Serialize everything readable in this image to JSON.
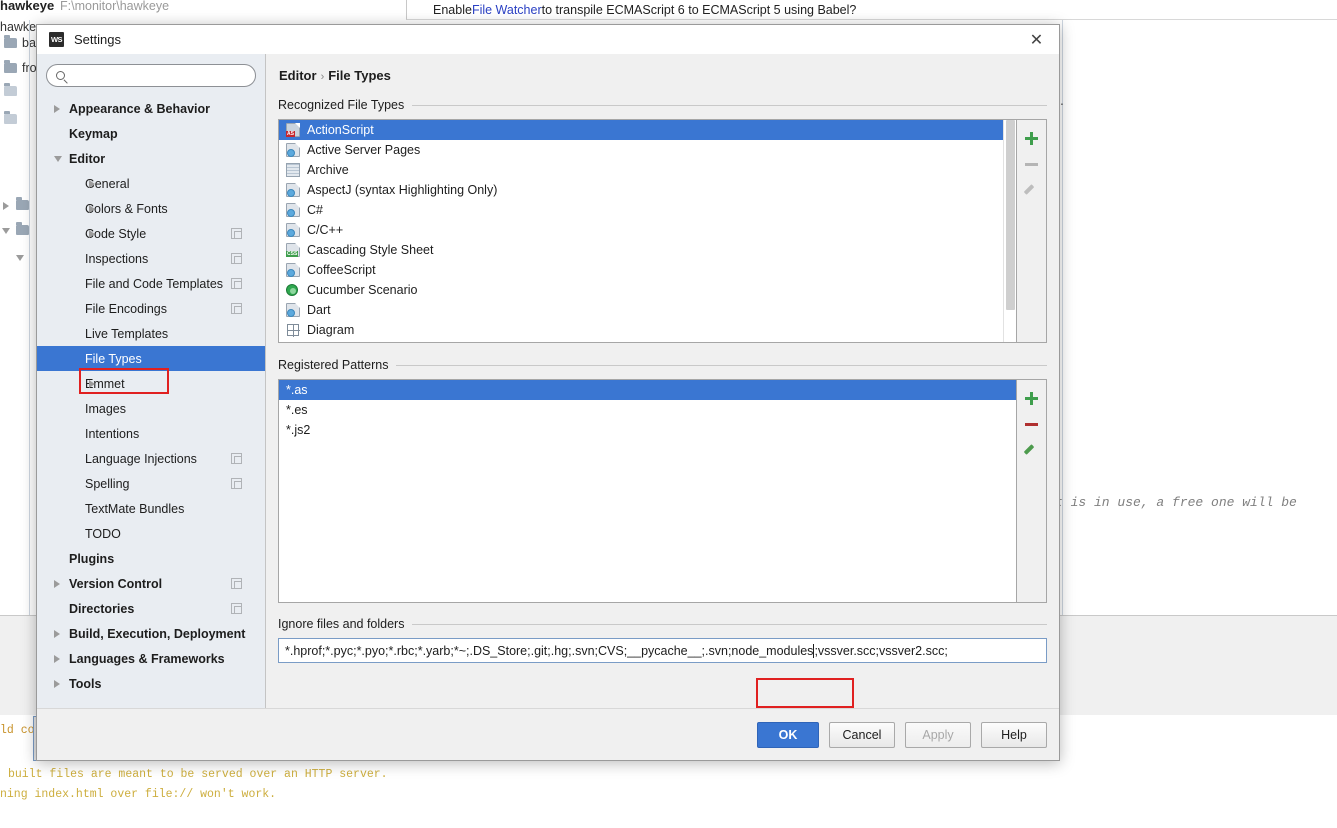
{
  "background": {
    "project_name": "hawkeye",
    "project_path": "F:\\monitor\\hawkeye",
    "tree_rows": [
      "hawkeye",
      "bac",
      "fro"
    ],
    "notification": {
      "prefix": "Enable ",
      "link": "File Watcher",
      "suffix": " to transpile ECMAScript 6 to ECMAScript 5 using Babel?"
    },
    "editor_italic_text": "t is in use, a free one will be",
    "console_lines": [
      "ld com",
      "built files are meant to be served over an HTTP server.",
      "ning index.html over file:// won't work."
    ],
    "dot": "."
  },
  "dialog": {
    "icon": "webstorm-icon",
    "title": "Settings",
    "close_icon": "close-icon",
    "search": {
      "icon": "search-icon",
      "value": "",
      "placeholder": ""
    },
    "tree": [
      {
        "label": "Appearance & Behavior",
        "level": 0,
        "bold": true,
        "arrow": "right",
        "copy": false,
        "selected": false
      },
      {
        "label": "Keymap",
        "level": 0,
        "bold": true,
        "arrow": "none",
        "copy": false,
        "selected": false
      },
      {
        "label": "Editor",
        "level": 0,
        "bold": true,
        "arrow": "down",
        "copy": false,
        "selected": false
      },
      {
        "label": "General",
        "level": 1,
        "bold": false,
        "arrow": "right",
        "copy": false,
        "selected": false
      },
      {
        "label": "Colors & Fonts",
        "level": 1,
        "bold": false,
        "arrow": "right",
        "copy": false,
        "selected": false
      },
      {
        "label": "Code Style",
        "level": 1,
        "bold": false,
        "arrow": "right",
        "copy": true,
        "selected": false
      },
      {
        "label": "Inspections",
        "level": 1,
        "bold": false,
        "arrow": "none",
        "copy": true,
        "selected": false
      },
      {
        "label": "File and Code Templates",
        "level": 1,
        "bold": false,
        "arrow": "none",
        "copy": true,
        "selected": false
      },
      {
        "label": "File Encodings",
        "level": 1,
        "bold": false,
        "arrow": "none",
        "copy": true,
        "selected": false
      },
      {
        "label": "Live Templates",
        "level": 1,
        "bold": false,
        "arrow": "none",
        "copy": false,
        "selected": false
      },
      {
        "label": "File Types",
        "level": 1,
        "bold": false,
        "arrow": "none",
        "copy": false,
        "selected": true
      },
      {
        "label": "Emmet",
        "level": 1,
        "bold": false,
        "arrow": "right",
        "copy": false,
        "selected": false
      },
      {
        "label": "Images",
        "level": 1,
        "bold": false,
        "arrow": "none",
        "copy": false,
        "selected": false
      },
      {
        "label": "Intentions",
        "level": 1,
        "bold": false,
        "arrow": "none",
        "copy": false,
        "selected": false
      },
      {
        "label": "Language Injections",
        "level": 1,
        "bold": false,
        "arrow": "none",
        "copy": true,
        "selected": false
      },
      {
        "label": "Spelling",
        "level": 1,
        "bold": false,
        "arrow": "none",
        "copy": true,
        "selected": false
      },
      {
        "label": "TextMate Bundles",
        "level": 1,
        "bold": false,
        "arrow": "none",
        "copy": false,
        "selected": false
      },
      {
        "label": "TODO",
        "level": 1,
        "bold": false,
        "arrow": "none",
        "copy": false,
        "selected": false
      },
      {
        "label": "Plugins",
        "level": 0,
        "bold": true,
        "arrow": "none",
        "copy": false,
        "selected": false
      },
      {
        "label": "Version Control",
        "level": 0,
        "bold": true,
        "arrow": "right",
        "copy": true,
        "selected": false
      },
      {
        "label": "Directories",
        "level": 0,
        "bold": true,
        "arrow": "none",
        "copy": true,
        "selected": false
      },
      {
        "label": "Build, Execution, Deployment",
        "level": 0,
        "bold": true,
        "arrow": "right",
        "copy": false,
        "selected": false
      },
      {
        "label": "Languages & Frameworks",
        "level": 0,
        "bold": true,
        "arrow": "right",
        "copy": false,
        "selected": false
      },
      {
        "label": "Tools",
        "level": 0,
        "bold": true,
        "arrow": "right",
        "copy": false,
        "selected": false
      }
    ],
    "breadcrumb": {
      "root": "Editor",
      "separator": "›",
      "current": "File Types"
    },
    "recognized": {
      "label": "Recognized File Types",
      "items": [
        {
          "name": "ActionScript",
          "icon": "actionscript-icon",
          "selected": true
        },
        {
          "name": "Active Server Pages",
          "icon": "asp-icon",
          "selected": false
        },
        {
          "name": "Archive",
          "icon": "archive-icon",
          "selected": false
        },
        {
          "name": "AspectJ (syntax Highlighting Only)",
          "icon": "aspectj-icon",
          "selected": false
        },
        {
          "name": "C#",
          "icon": "csharp-icon",
          "selected": false
        },
        {
          "name": "C/C++",
          "icon": "cpp-icon",
          "selected": false
        },
        {
          "name": "Cascading Style Sheet",
          "icon": "css-icon",
          "selected": false
        },
        {
          "name": "CoffeeScript",
          "icon": "coffeescript-icon",
          "selected": false
        },
        {
          "name": "Cucumber Scenario",
          "icon": "cucumber-icon",
          "selected": false
        },
        {
          "name": "Dart",
          "icon": "dart-icon",
          "selected": false
        },
        {
          "name": "Diagram",
          "icon": "diagram-icon",
          "selected": false
        }
      ],
      "tools": [
        {
          "name": "add-file-type-button",
          "icon": "plus-icon",
          "enabled": true
        },
        {
          "name": "remove-file-type-button",
          "icon": "minus-icon",
          "enabled": false
        },
        {
          "name": "edit-file-type-button",
          "icon": "pencil-icon",
          "enabled": false
        }
      ]
    },
    "patterns": {
      "label": "Registered Patterns",
      "items": [
        {
          "name": "*.as",
          "selected": true
        },
        {
          "name": "*.es",
          "selected": false
        },
        {
          "name": "*.js2",
          "selected": false
        }
      ],
      "tools": [
        {
          "name": "add-pattern-button",
          "icon": "plus-icon",
          "enabled": true
        },
        {
          "name": "remove-pattern-button",
          "icon": "minus-icon",
          "enabled": true
        },
        {
          "name": "edit-pattern-button",
          "icon": "pencil-icon",
          "enabled": true
        }
      ]
    },
    "ignore": {
      "label": "Ignore files and folders",
      "value_before": "*.hprof;*.pyc;*.pyo;*.rbc;*.yarb;*~;.DS_Store;.git;.hg;.svn;CVS;__pycache__;.svn;",
      "value_highlighted": "node_modules",
      "value_after": ";vssver.scc;vssver2.scc;"
    },
    "buttons": [
      {
        "label": "OK",
        "style": "primary",
        "name": "ok-button"
      },
      {
        "label": "Cancel",
        "style": "normal",
        "name": "cancel-button"
      },
      {
        "label": "Apply",
        "style": "disabled",
        "name": "apply-button"
      },
      {
        "label": "Help",
        "style": "normal",
        "name": "help-button"
      }
    ]
  },
  "colors": {
    "accent": "#3a76d2",
    "annotation": "#e02020",
    "link": "#2b41c4",
    "console": "#c8922a"
  }
}
